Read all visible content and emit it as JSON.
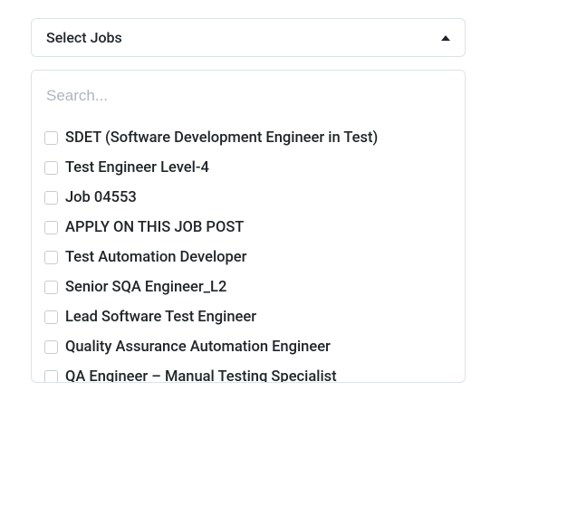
{
  "select": {
    "trigger_label": "Select Jobs"
  },
  "search": {
    "placeholder": "Search..."
  },
  "options": [
    {
      "label": "SDET (Software Development Engineer in Test)"
    },
    {
      "label": "Test Engineer Level-4"
    },
    {
      "label": "Job 04553"
    },
    {
      "label": "APPLY ON THIS JOB POST"
    },
    {
      "label": "Test Automation Developer"
    },
    {
      "label": "Senior SQA Engineer_L2"
    },
    {
      "label": "Lead Software Test Engineer"
    },
    {
      "label": "Quality Assurance Automation Engineer"
    },
    {
      "label": "QA Engineer – Manual Testing Specialist"
    }
  ]
}
